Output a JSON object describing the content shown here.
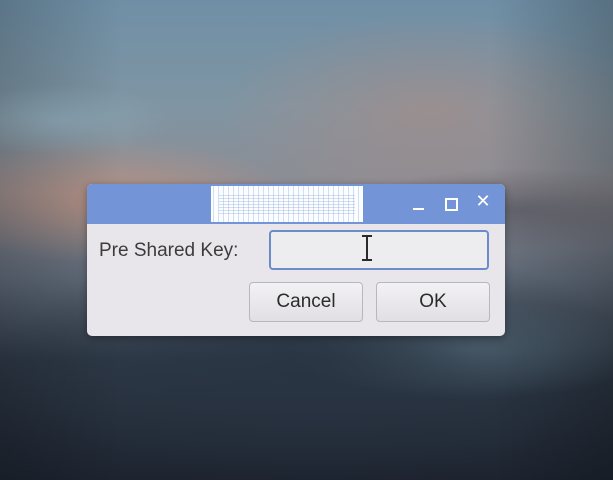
{
  "dialog": {
    "title": "",
    "key_label": "Pre Shared Key:",
    "key_value": "",
    "buttons": {
      "cancel_label": "Cancel",
      "ok_label": "OK"
    },
    "window_controls": {
      "minimize_icon": "minimize-icon",
      "maximize_icon": "maximize-icon",
      "close_icon": "close-icon"
    }
  },
  "colors": {
    "titlebar": "#7394d6",
    "dialog_background": "#e8e6eb",
    "input_border": "#6b8bc9"
  }
}
